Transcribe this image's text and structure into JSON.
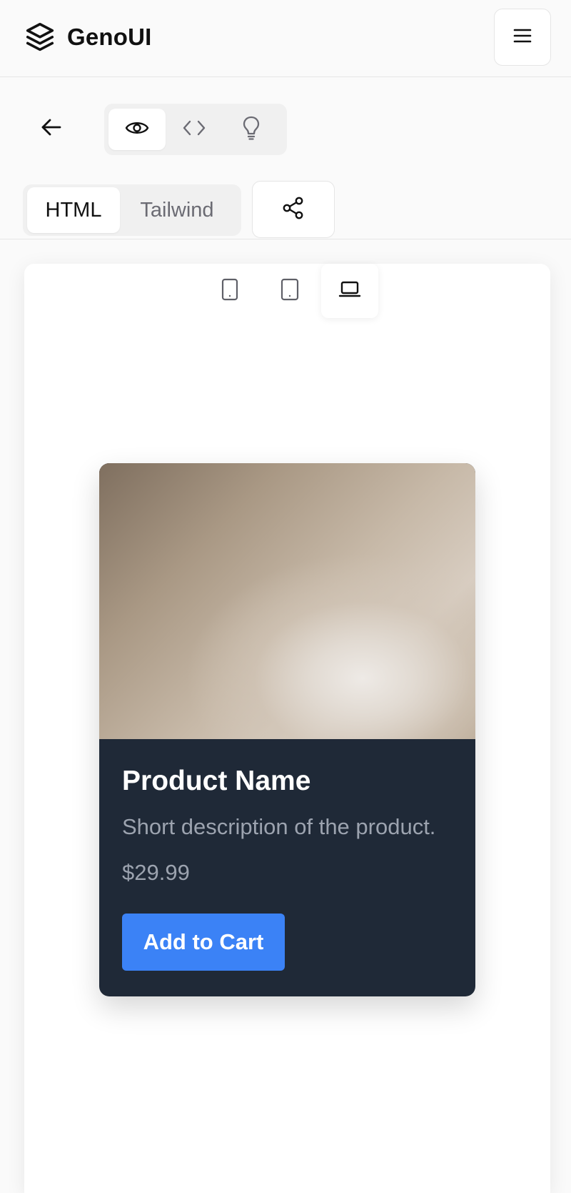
{
  "app": {
    "name": "GenoUI",
    "logo_icon": "layers-stack-icon",
    "menu_icon": "hamburger-menu-icon"
  },
  "toolbar": {
    "back_icon": "arrow-left-icon",
    "view_modes": [
      {
        "icon": "eye-icon",
        "active": true
      },
      {
        "icon": "code-brackets-icon",
        "active": false
      },
      {
        "icon": "lightbulb-icon",
        "active": false
      }
    ],
    "languages": [
      {
        "label": "HTML",
        "active": true
      },
      {
        "label": "Tailwind",
        "active": false
      }
    ],
    "share_icon": "share-nodes-icon"
  },
  "preview": {
    "devices": [
      {
        "icon": "phone-icon",
        "active": false
      },
      {
        "icon": "tablet-icon",
        "active": false
      },
      {
        "icon": "laptop-icon",
        "active": true
      }
    ],
    "card": {
      "title": "Product Name",
      "description": "Short description of the product.",
      "price": "$29.99",
      "button_label": "Add to Cart",
      "colors": {
        "card_bg": "#1f2937",
        "muted_text": "#9ca3af",
        "button_bg": "#3b82f6"
      }
    }
  }
}
